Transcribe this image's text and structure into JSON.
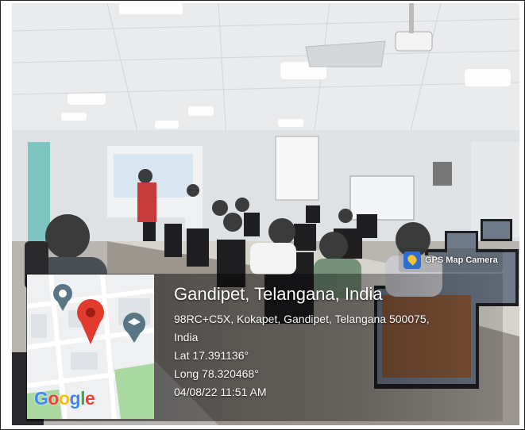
{
  "badge": {
    "label": "GPS Map Camera"
  },
  "location": {
    "title": "Gandipet, Telangana, India",
    "address_line1": "98RC+C5X, Kokapet, Gandipet, Telangana 500075,",
    "address_line2": "India",
    "latitude": "Lat 17.391136°",
    "longitude": "Long 78.320468°",
    "datetime": "04/08/22 11:51 AM"
  },
  "map": {
    "logo": "Google",
    "logo_colors": [
      "#4285F4",
      "#EA4335",
      "#FBBC05",
      "#4285F4",
      "#34A853",
      "#EA4335"
    ]
  },
  "icons": [
    "gps-map-camera-icon",
    "location-pin-icon",
    "education-pin-icon",
    "google-logo"
  ]
}
